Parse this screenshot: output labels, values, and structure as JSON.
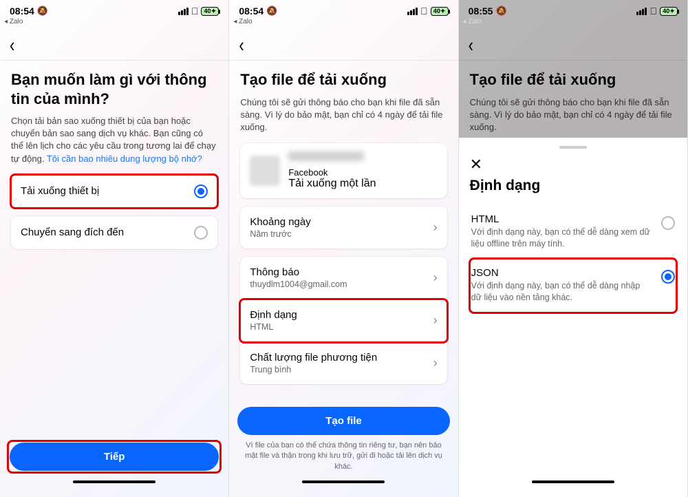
{
  "status": {
    "time1": "08:54",
    "time2": "08:54",
    "time3": "08:55",
    "app": "Zalo",
    "battery": "40"
  },
  "s1": {
    "title": "Bạn muốn làm gì với thông tin của mình?",
    "desc_pre": "Chọn tải bản sao xuống thiết bị của bạn hoặc chuyển bản sao sang dịch vụ khác. Bạn cũng có thể lên lịch cho các yêu cầu trong tương lai để chạy tự động. ",
    "desc_link": "Tôi cần bao nhiêu dung lượng bộ nhớ?",
    "opt1": "Tải xuống thiết bị",
    "opt2": "Chuyển sang đích đến",
    "button": "Tiếp"
  },
  "s2": {
    "title": "Tạo file để tải xuống",
    "desc": "Chúng tôi sẽ gửi thông báo cho bạn khi file đã sẵn sàng. Vì lý do bảo mật, bạn chỉ có 4 ngày để tải file xuống.",
    "fb_label": "Facebook",
    "fb_sub": "Tải xuống một lần",
    "rows": [
      {
        "label": "Khoảng ngày",
        "sub": "Năm trước"
      },
      {
        "label": "Thông báo",
        "sub": "thuydlm1004@gmail.com"
      },
      {
        "label": "Định dạng",
        "sub": "HTML"
      },
      {
        "label": "Chất lượng file phương tiện",
        "sub": "Trung bình"
      }
    ],
    "button": "Tạo file",
    "footnote": "Vì file của bạn có thể chứa thông tin riêng tư, bạn nên bảo mật file và thận trọng khi lưu trữ, gửi đi hoặc tải lên dịch vụ khác."
  },
  "s3": {
    "title": "Tạo file để tải xuống",
    "desc": "Chúng tôi sẽ gửi thông báo cho bạn khi file đã sẵn sàng. Vì lý do bảo mật, bạn chỉ có 4 ngày để tải file xuống.",
    "sheet_title": "Định dạng",
    "opts": [
      {
        "label": "HTML",
        "desc": "Với định dạng này, bạn có thể dễ dàng xem dữ liệu offline trên máy tính."
      },
      {
        "label": "JSON",
        "desc": "Với định dạng này, bạn có thể dễ dàng nhập dữ liệu vào nền tảng khác."
      }
    ]
  }
}
